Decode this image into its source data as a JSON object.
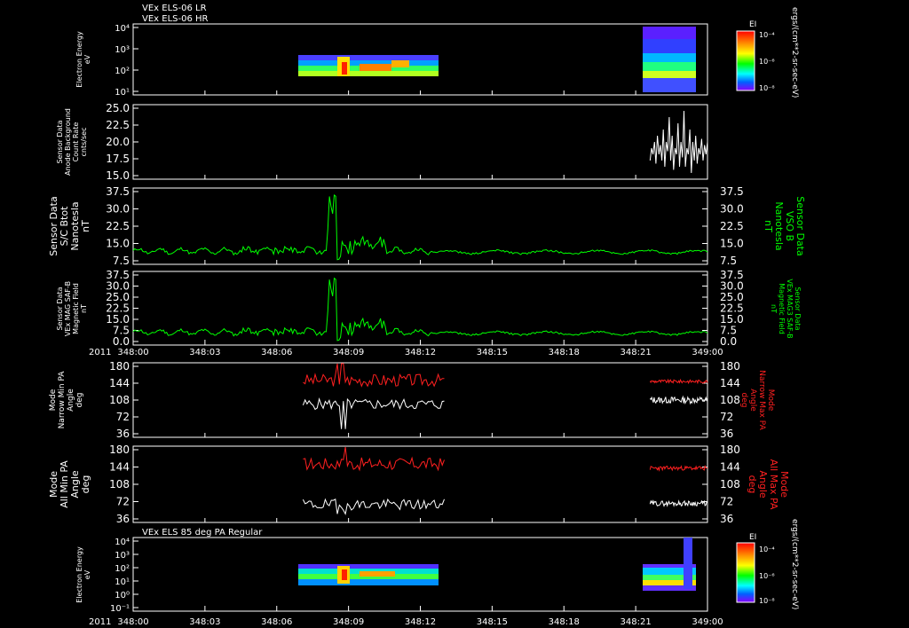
{
  "header": {
    "line1": "VEx ELS-06 LR",
    "line2": "VEx ELS-06 HR",
    "bottom_title": "VEx ELS 85 deg PA Regular",
    "year": "2011"
  },
  "colors": {
    "white": "#ffffff",
    "green": "#00ff00",
    "red": "#ff2020",
    "background": "#000000"
  },
  "time_axis": {
    "ticks": [
      "348:00",
      "348:03",
      "348:06",
      "348:09",
      "348:12",
      "348:15",
      "348:18",
      "348:21",
      "349:00"
    ],
    "range_min": [
      0,
      24
    ]
  },
  "right_titles": {
    "cb1": "ergs/(cm**2-sr-sec-eV)",
    "cb2": "ergs/(cm**2-sr-sec-eV)"
  },
  "chart_data": [
    {
      "type": "heatmap",
      "ylabel": [
        "Electron Energy",
        "eV"
      ],
      "yticks": [
        "10⁴",
        "10³",
        "10²",
        "10¹"
      ],
      "colorbar": {
        "label": "EI",
        "ticks": [
          "10⁻⁴",
          "10⁻⁶",
          "10⁻⁸"
        ],
        "scale": "log"
      },
      "blocks_min": [
        [
          7.1,
          13.0
        ],
        [
          21.6,
          24.0
        ]
      ]
    },
    {
      "type": "line",
      "ylabel": [
        "Sensor Data",
        "Anode Background",
        "Count Rate",
        "cnts/sec"
      ],
      "yticks": [
        "25.0",
        "22.5",
        "20.0",
        "17.5",
        "15.0"
      ],
      "ylim": [
        13.0,
        25.0
      ],
      "series": [
        {
          "color": "white",
          "segment_min": [
            21.6,
            24.0
          ],
          "values": [
            16,
            18,
            17,
            19,
            15.5,
            20,
            17,
            18.5,
            16,
            21,
            15,
            19,
            17.5,
            23,
            16,
            20,
            14.5,
            18,
            17,
            22,
            15,
            19,
            16.5,
            24,
            15,
            18,
            17,
            21,
            14,
            19,
            16,
            20,
            15.5,
            18,
            17,
            19.5,
            16,
            18.5,
            17,
            19
          ]
        }
      ]
    },
    {
      "type": "line",
      "ylabel": [
        "Sensor Data",
        "S/C Btot",
        "Nanotesla",
        "nT"
      ],
      "right_label": [
        "Sensor Data",
        "VSO B",
        "Nanotesla",
        "nT"
      ],
      "yticks": [
        "37.5",
        "30.0",
        "22.5",
        "15.0",
        "7.5"
      ],
      "ylim": [
        0,
        37.5
      ],
      "series": [
        {
          "color": "green"
        }
      ]
    },
    {
      "type": "line",
      "ylabel": [
        "Sensor Data",
        "VEx MAG SAF-B",
        "Magnetic Field",
        "nT"
      ],
      "right_label": [
        "Sensor Data",
        "VEx MAG3 SAF-B",
        "Magnetic Field",
        "nT"
      ],
      "yticks": [
        "37.5",
        "30.0",
        "25.0",
        "22.5",
        "15.0",
        "7.5",
        "0.0"
      ],
      "ylim": [
        0,
        37.5
      ],
      "series": [
        {
          "color": "green"
        }
      ]
    },
    {
      "type": "line",
      "ylabel": [
        "Mode",
        "Narrow Min PA",
        "Angle",
        "deg"
      ],
      "right_label": [
        "Mode",
        "Narrow Max PA",
        "Angle",
        "deg"
      ],
      "yticks": [
        "180",
        "144",
        "108",
        "72",
        "36"
      ],
      "ylim": [
        0,
        180
      ],
      "series": [
        {
          "name": "Max PA",
          "color": "red"
        },
        {
          "name": "Min PA",
          "color": "white"
        }
      ]
    },
    {
      "type": "line",
      "ylabel": [
        "Mode",
        "All Min PA",
        "Angle",
        "deg"
      ],
      "right_label": [
        "Mode",
        "All Max PA",
        "Angle",
        "deg"
      ],
      "yticks": [
        "180",
        "144",
        "108",
        "72",
        "36"
      ],
      "ylim": [
        0,
        180
      ],
      "series": [
        {
          "name": "Max PA",
          "color": "red"
        },
        {
          "name": "Min PA",
          "color": "white"
        }
      ]
    },
    {
      "type": "heatmap",
      "ylabel": [
        "Electron Energy",
        "eV"
      ],
      "yticks": [
        "10⁴",
        "10³",
        "10²",
        "10¹",
        "10⁰",
        "10⁻¹"
      ],
      "colorbar": {
        "label": "EI",
        "ticks": [
          "10⁻⁴",
          "10⁻⁶",
          "10⁻⁸"
        ],
        "scale": "log"
      },
      "blocks_min": [
        [
          7.1,
          13.0
        ],
        [
          21.6,
          24.0
        ]
      ]
    }
  ]
}
